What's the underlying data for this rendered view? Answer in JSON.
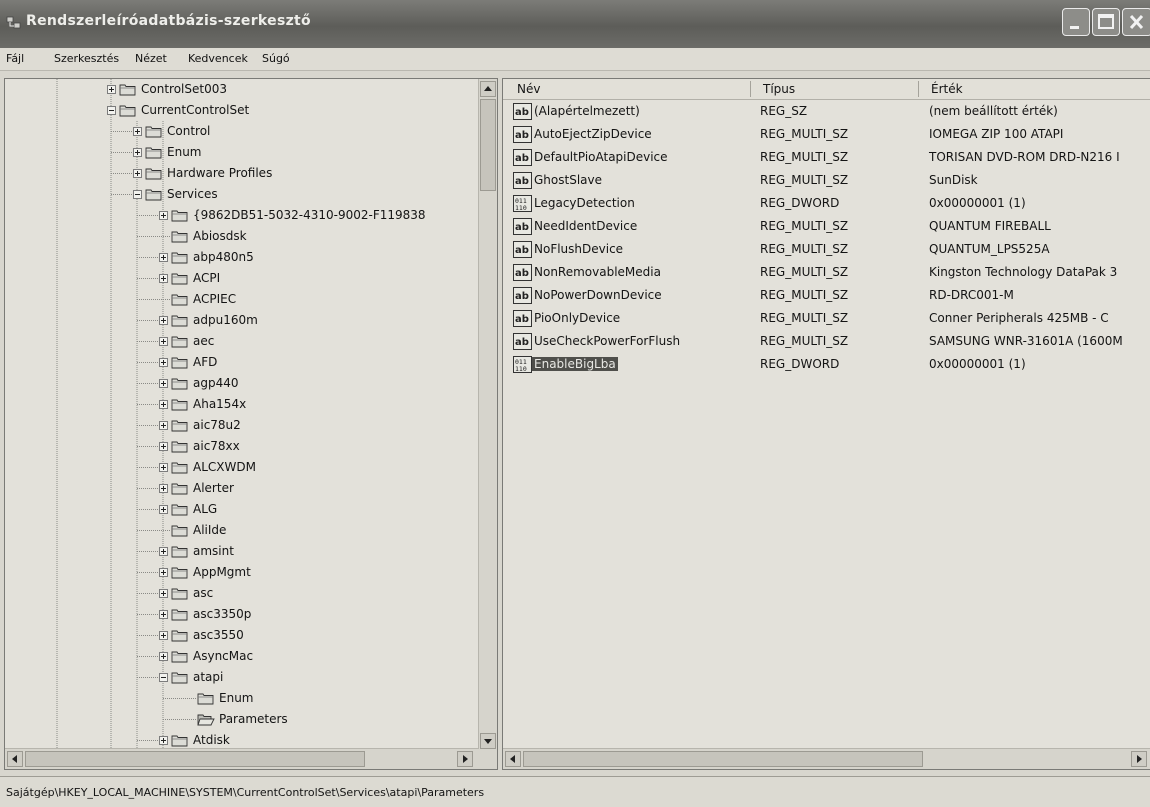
{
  "window": {
    "title": "Rendszerleíróadatbázis-szerkesztő",
    "buttons": [
      "minimize",
      "maximize",
      "close"
    ]
  },
  "menu": [
    "Fájl",
    "Szerkesztés",
    "Nézet",
    "Kedvencek",
    "Súgó"
  ],
  "tree": {
    "items": [
      {
        "label": "ControlSet003",
        "level": 0,
        "expander": "plus"
      },
      {
        "label": "CurrentControlSet",
        "level": 0,
        "expander": "minus"
      },
      {
        "label": "Control",
        "level": 1,
        "expander": "plus"
      },
      {
        "label": "Enum",
        "level": 1,
        "expander": "plus"
      },
      {
        "label": "Hardware Profiles",
        "level": 1,
        "expander": "plus"
      },
      {
        "label": "Services",
        "level": 1,
        "expander": "minus"
      },
      {
        "label": "{9862DB51-5032-4310-9002-F119838",
        "level": 2,
        "expander": "plus"
      },
      {
        "label": "Abiosdsk",
        "level": 2,
        "expander": "none"
      },
      {
        "label": "abp480n5",
        "level": 2,
        "expander": "plus"
      },
      {
        "label": "ACPI",
        "level": 2,
        "expander": "plus"
      },
      {
        "label": "ACPIEC",
        "level": 2,
        "expander": "none"
      },
      {
        "label": "adpu160m",
        "level": 2,
        "expander": "plus"
      },
      {
        "label": "aec",
        "level": 2,
        "expander": "plus"
      },
      {
        "label": "AFD",
        "level": 2,
        "expander": "plus"
      },
      {
        "label": "agp440",
        "level": 2,
        "expander": "plus"
      },
      {
        "label": "Aha154x",
        "level": 2,
        "expander": "plus"
      },
      {
        "label": "aic78u2",
        "level": 2,
        "expander": "plus"
      },
      {
        "label": "aic78xx",
        "level": 2,
        "expander": "plus"
      },
      {
        "label": "ALCXWDM",
        "level": 2,
        "expander": "plus"
      },
      {
        "label": "Alerter",
        "level": 2,
        "expander": "plus"
      },
      {
        "label": "ALG",
        "level": 2,
        "expander": "plus"
      },
      {
        "label": "AliIde",
        "level": 2,
        "expander": "none"
      },
      {
        "label": "amsint",
        "level": 2,
        "expander": "plus"
      },
      {
        "label": "AppMgmt",
        "level": 2,
        "expander": "plus"
      },
      {
        "label": "asc",
        "level": 2,
        "expander": "plus"
      },
      {
        "label": "asc3350p",
        "level": 2,
        "expander": "plus"
      },
      {
        "label": "asc3550",
        "level": 2,
        "expander": "plus"
      },
      {
        "label": "AsyncMac",
        "level": 2,
        "expander": "plus"
      },
      {
        "label": "atapi",
        "level": 2,
        "expander": "minus"
      },
      {
        "label": "Enum",
        "level": 3,
        "expander": "none"
      },
      {
        "label": "Parameters",
        "level": 3,
        "expander": "none",
        "open": true
      },
      {
        "label": "Atdisk",
        "level": 2,
        "expander": "plus"
      }
    ]
  },
  "list": {
    "columns": [
      "Név",
      "Típus",
      "Érték"
    ],
    "rows": [
      {
        "name": "(Alapértelmezett)",
        "type": "REG_SZ",
        "data": "(nem beállított érték)",
        "icon": "string-value-icon"
      },
      {
        "name": "AutoEjectZipDevice",
        "type": "REG_MULTI_SZ",
        "data": "IOMEGA  ZIP 100      ATAPI",
        "icon": "string-value-icon"
      },
      {
        "name": "DefaultPioAtapiDevice",
        "type": "REG_MULTI_SZ",
        "data": "TORISAN DVD-ROM DRD-N216 I",
        "icon": "string-value-icon"
      },
      {
        "name": "GhostSlave",
        "type": "REG_MULTI_SZ",
        "data": "SunDisk",
        "icon": "string-value-icon"
      },
      {
        "name": "LegacyDetection",
        "type": "REG_DWORD",
        "data": "0x00000001 (1)",
        "icon": "binary-value-icon"
      },
      {
        "name": "NeedIdentDevice",
        "type": "REG_MULTI_SZ",
        "data": "QUANTUM FIREBALL",
        "icon": "string-value-icon"
      },
      {
        "name": "NoFlushDevice",
        "type": "REG_MULTI_SZ",
        "data": "QUANTUM_LPS525A",
        "icon": "string-value-icon"
      },
      {
        "name": "NonRemovableMedia",
        "type": "REG_MULTI_SZ",
        "data": "Kingston Technology DataPak 3",
        "icon": "string-value-icon"
      },
      {
        "name": "NoPowerDownDevice",
        "type": "REG_MULTI_SZ",
        "data": "RD-DRC001-M",
        "icon": "string-value-icon"
      },
      {
        "name": "PioOnlyDevice",
        "type": "REG_MULTI_SZ",
        "data": "   Conner Peripherals 425MB - C",
        "icon": "string-value-icon"
      },
      {
        "name": "UseCheckPowerForFlush",
        "type": "REG_MULTI_SZ",
        "data": "SAMSUNG WNR-31601A (1600M",
        "icon": "string-value-icon"
      },
      {
        "name": "EnableBigLba",
        "type": "REG_DWORD",
        "data": "0x00000001 (1)",
        "icon": "binary-value-icon",
        "selected": true
      }
    ]
  },
  "status": {
    "path": "Sajátgép\\HKEY_LOCAL_MACHINE\\SYSTEM\\CurrentControlSet\\Services\\atapi\\Parameters"
  }
}
